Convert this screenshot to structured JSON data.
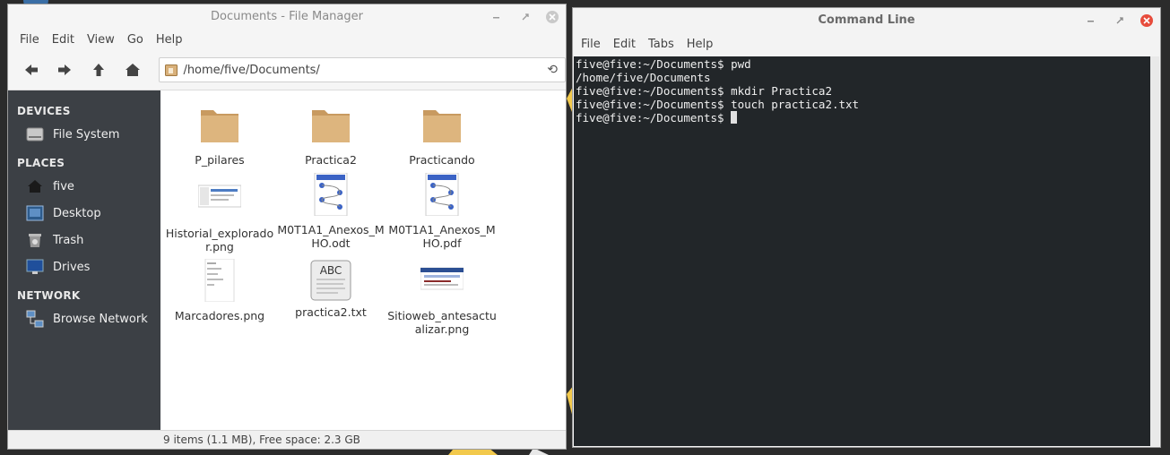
{
  "file_manager": {
    "title": "Documents - File Manager",
    "menu": [
      "File",
      "Edit",
      "View",
      "Go",
      "Help"
    ],
    "path": "/home/five/Documents/",
    "sidebar": {
      "devices_heading": "DEVICES",
      "devices": [
        {
          "label": "File System",
          "icon": "drive-icon"
        }
      ],
      "places_heading": "PLACES",
      "places": [
        {
          "label": "five",
          "icon": "home-icon"
        },
        {
          "label": "Desktop",
          "icon": "desktop-icon"
        },
        {
          "label": "Trash",
          "icon": "trash-icon"
        },
        {
          "label": "Drives",
          "icon": "monitor-icon"
        }
      ],
      "network_heading": "NETWORK",
      "network": [
        {
          "label": "Browse Network",
          "icon": "network-icon"
        }
      ]
    },
    "files": [
      {
        "name": "P_pilares",
        "type": "folder"
      },
      {
        "name": "Practica2",
        "type": "folder"
      },
      {
        "name": "Practicando",
        "type": "folder"
      },
      {
        "name": "Historial_explorador.png",
        "type": "image"
      },
      {
        "name": "M0T1A1_Anexos_MHO.odt",
        "type": "document"
      },
      {
        "name": "M0T1A1_Anexos_MHO.pdf",
        "type": "document"
      },
      {
        "name": "Marcadores.png",
        "type": "image"
      },
      {
        "name": "practica2.txt",
        "type": "text",
        "icon_text": "ABC"
      },
      {
        "name": "Sitioweb_antesactualizar.png",
        "type": "image"
      }
    ],
    "status": "9 items (1.1 MB), Free space: 2.3 GB"
  },
  "terminal": {
    "title": "Command Line",
    "menu": [
      "File",
      "Edit",
      "Tabs",
      "Help"
    ],
    "lines": [
      "five@five:~/Documents$ pwd",
      "/home/five/Documents",
      "five@five:~/Documents$ mkdir Practica2",
      "five@five:~/Documents$ touch practica2.txt",
      "five@five:~/Documents$ "
    ]
  },
  "colors": {
    "sidebar_bg": "#3c4045",
    "terminal_bg": "#222629",
    "folder": "#d8b07a",
    "close_red": "#e74c3c"
  }
}
